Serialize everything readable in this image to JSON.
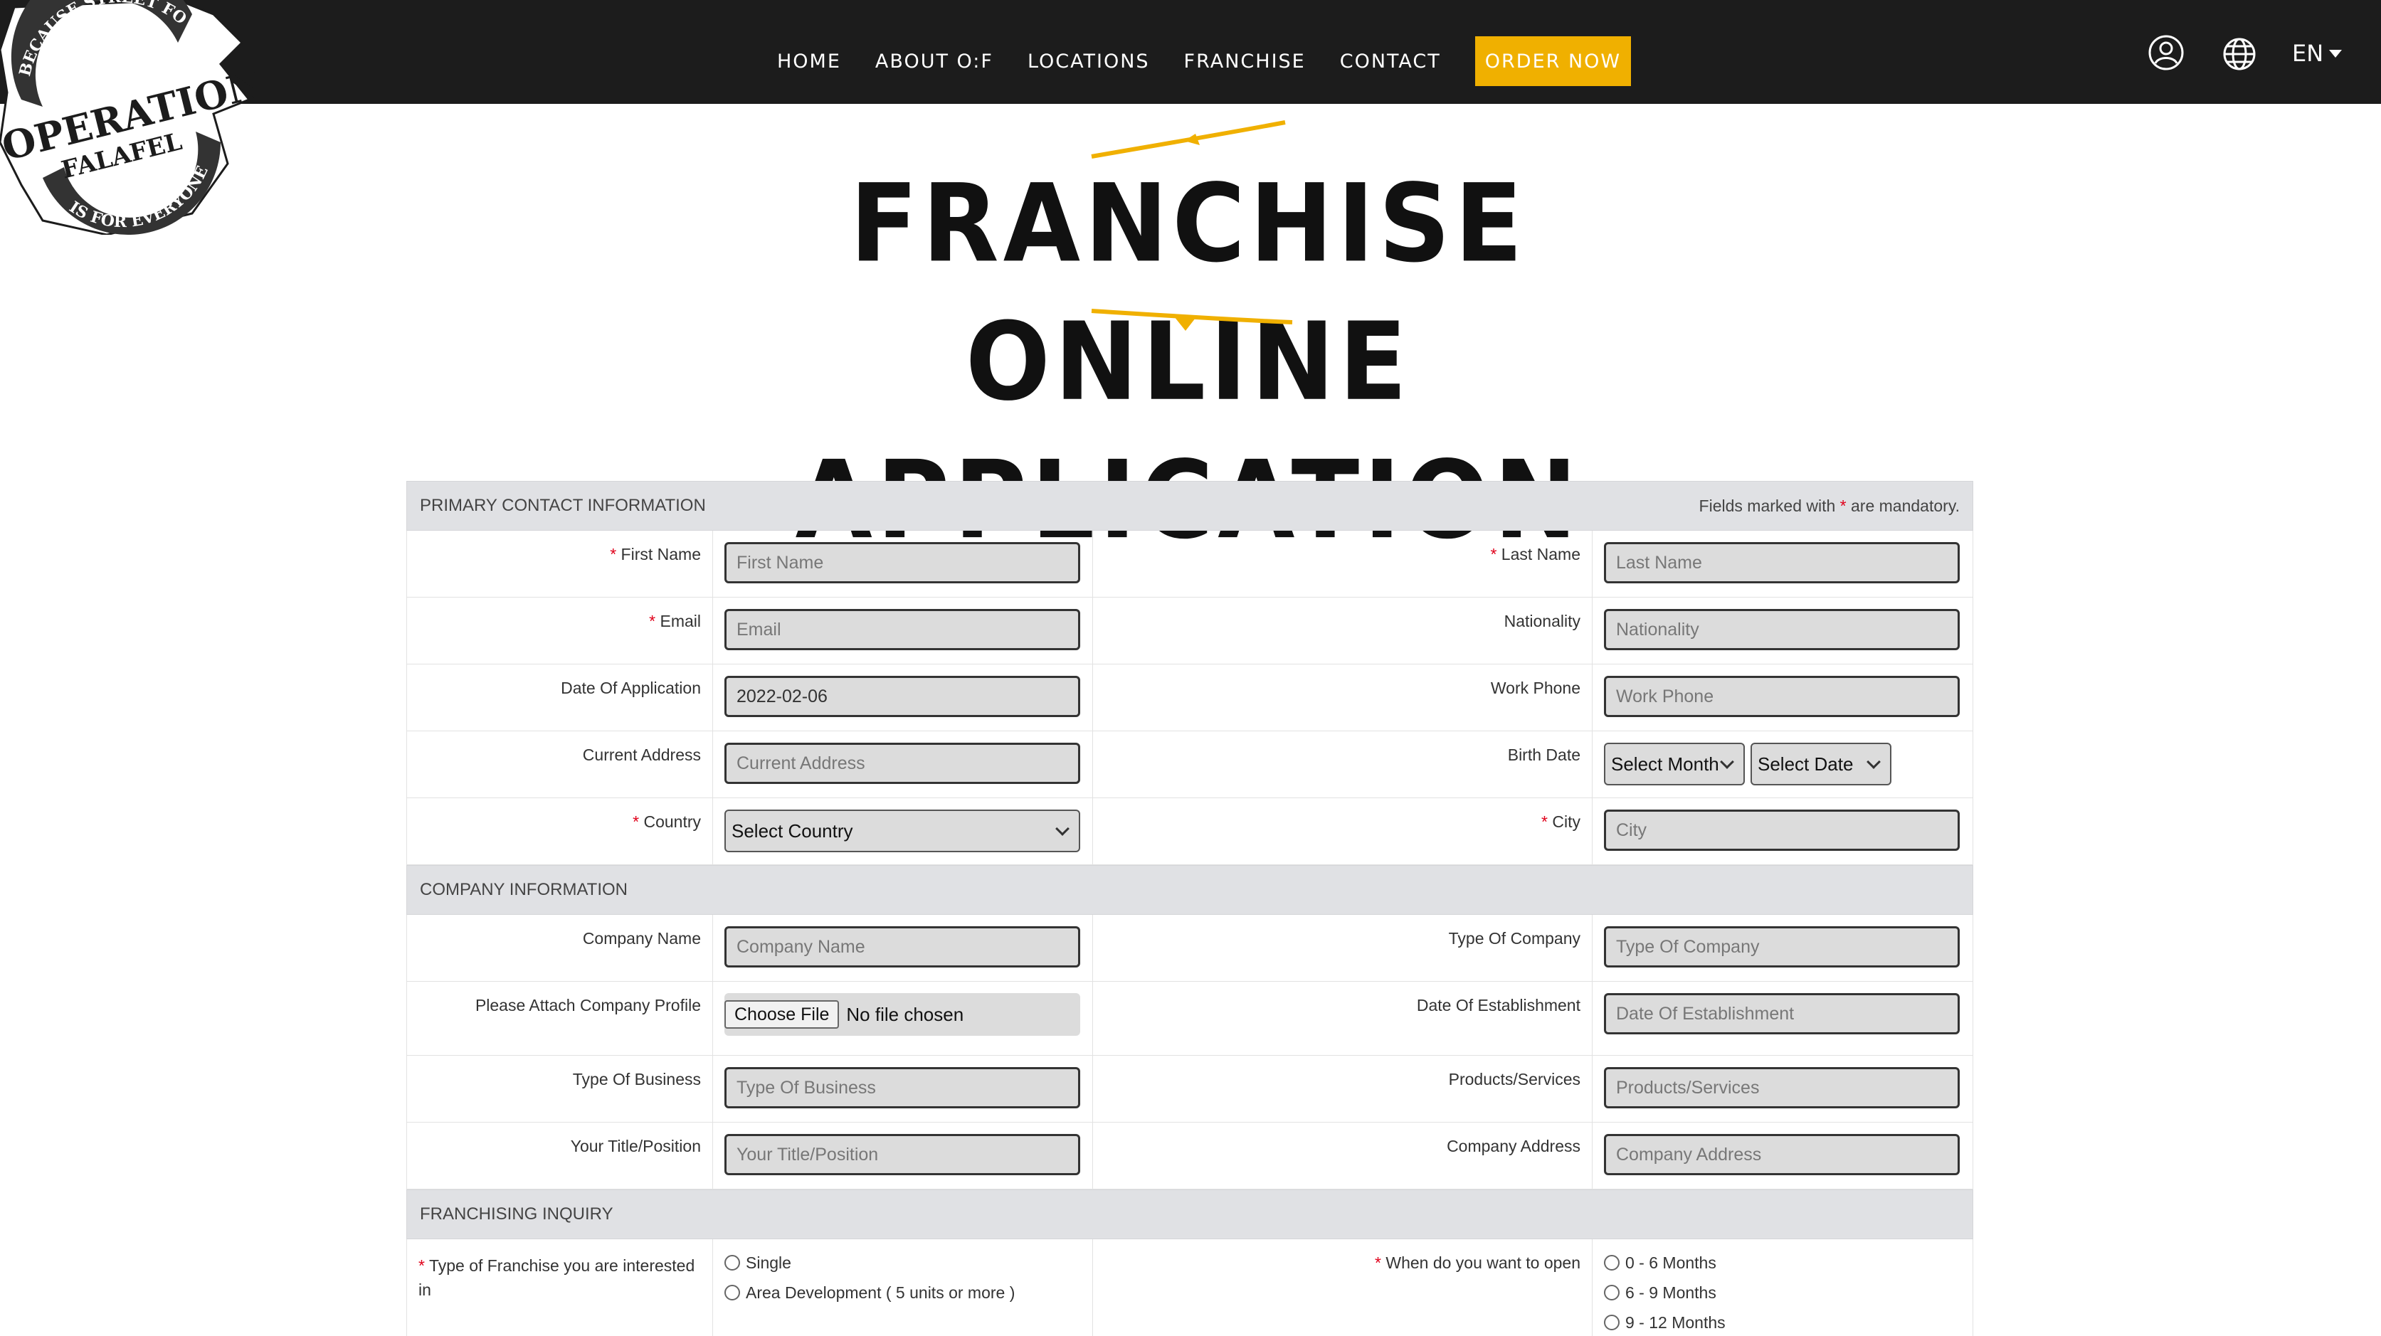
{
  "nav": {
    "items": [
      "HOME",
      "ABOUT O:F",
      "LOCATIONS",
      "FRANCHISE",
      "CONTACT"
    ],
    "order_now": "ORDER NOW",
    "lang": "EN"
  },
  "logo": {
    "top": "BECAUSE STREET FOOD",
    "main": "OPERATION:",
    "sub": "FALAFEL",
    "bottom": "IS FOR EVERYONE"
  },
  "page_title": "FRANCHISE ONLINE APPLICATION",
  "colors": {
    "accent": "#f0b000",
    "nav_bg": "#1c1c1c",
    "required": "#e0001a"
  },
  "primary": {
    "heading": "PRIMARY CONTACT INFORMATION",
    "note_before": "Fields marked with ",
    "note_star": "*",
    "note_after": " are mandatory.",
    "first_name": {
      "label": "First Name",
      "placeholder": "First Name"
    },
    "last_name": {
      "label": "Last Name",
      "placeholder": "Last Name"
    },
    "email": {
      "label": "Email",
      "placeholder": "Email"
    },
    "nationality": {
      "label": "Nationality",
      "placeholder": "Nationality"
    },
    "date_of_application": {
      "label": "Date Of Application",
      "value": "2022-02-06"
    },
    "work_phone": {
      "label": "Work Phone",
      "placeholder": "Work Phone"
    },
    "current_address": {
      "label": "Current Address",
      "placeholder": "Current Address"
    },
    "birth_date": {
      "label": "Birth Date",
      "month": "Select Month",
      "date": "Select Date"
    },
    "country": {
      "label": "Country",
      "value": "Select Country"
    },
    "city": {
      "label": "City",
      "placeholder": "City"
    }
  },
  "company": {
    "heading": "COMPANY INFORMATION",
    "company_name": {
      "label": "Company Name",
      "placeholder": "Company Name"
    },
    "type_of_company": {
      "label": "Type Of Company",
      "placeholder": "Type Of Company"
    },
    "profile": {
      "label": "Please Attach Company Profile",
      "button": "Choose File",
      "status": "No file chosen"
    },
    "date_of_establishment": {
      "label": "Date Of Establishment",
      "placeholder": "Date Of Establishment"
    },
    "type_of_business": {
      "label": "Type Of Business",
      "placeholder": "Type Of Business"
    },
    "products_services": {
      "label": "Products/Services",
      "placeholder": "Products/Services"
    },
    "title_position": {
      "label": "Your Title/Position",
      "placeholder": "Your Title/Position"
    },
    "company_address": {
      "label": "Company Address",
      "placeholder": "Company Address"
    }
  },
  "inquiry": {
    "heading": "FRANCHISING INQUIRY",
    "franchise_type": {
      "label": "Type of Franchise you are interested in",
      "options": [
        "Single",
        "Area Development ( 5 units or more )"
      ]
    },
    "open_when": {
      "label": "When do you want to open",
      "options": [
        "0 - 6 Months",
        "6 - 9 Months",
        "9 - 12 Months"
      ]
    }
  }
}
